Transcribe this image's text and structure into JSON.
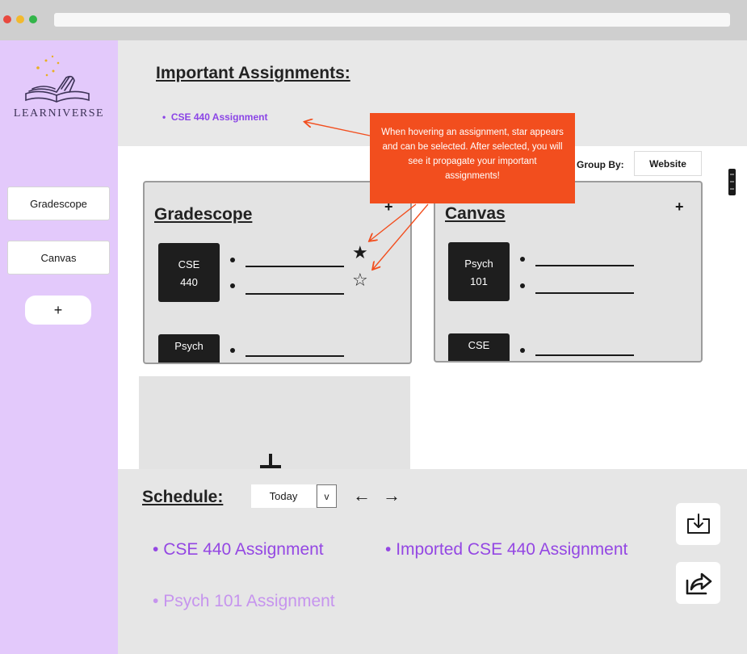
{
  "window": {
    "controls": [
      "close",
      "minimize",
      "maximize"
    ]
  },
  "sidebar": {
    "logo_text": "LEARNIVERSE",
    "items": [
      {
        "label": "Gradescope"
      },
      {
        "label": "Canvas"
      }
    ],
    "add_label": "+"
  },
  "important": {
    "title": "Important Assignments:",
    "items": [
      {
        "label": "CSE 440 Assignment"
      }
    ]
  },
  "group_by": {
    "label": "Group By:",
    "value": "Website"
  },
  "cards": [
    {
      "title": "Gradescope",
      "add_label": "+",
      "courses": [
        {
          "line1": "CSE",
          "line2": "440",
          "entries": 2,
          "stars": [
            "★",
            "☆"
          ]
        },
        {
          "line1": "Psych",
          "line2": "",
          "entries": 1
        }
      ]
    },
    {
      "title": "Canvas",
      "add_label": "+",
      "courses": [
        {
          "line1": "Psych",
          "line2": "101",
          "entries": 2
        },
        {
          "line1": "CSE",
          "line2": "",
          "entries": 1
        }
      ]
    }
  ],
  "annotation": {
    "text": "When hovering an assignment, star appears and can be selected. After selected, you will see it propagate your important assignments!"
  },
  "schedule": {
    "title": "Schedule:",
    "date_selector": "Today",
    "dropdown_label": "v",
    "prev_arrow": "←",
    "next_arrow": "→",
    "items": [
      {
        "label": "CSE 440 Assignment"
      },
      {
        "label": "Imported CSE 440 Assignment"
      },
      {
        "label": "Psych 101 Assignment"
      }
    ]
  },
  "colors": {
    "sidebar": "#e3c9fb",
    "accent_purple": "#9447e3",
    "annotation": "#f24e1e",
    "panel_gray": "#e3e3e3"
  },
  "icons": [
    "download-icon",
    "share-icon",
    "kebab-menu-icon",
    "logo-book-icon"
  ]
}
